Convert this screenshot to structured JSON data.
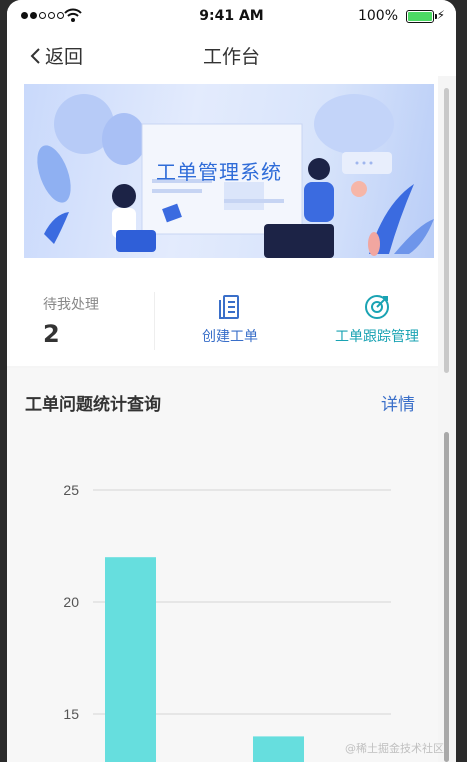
{
  "status_bar": {
    "time": "9:41 AM",
    "battery": "100%"
  },
  "nav": {
    "back_label": "返回",
    "title": "工作台"
  },
  "banner": {
    "title": "工单管理系统"
  },
  "quick": {
    "pending_label": "待我处理",
    "pending_count": "2",
    "create_label": "创建工单",
    "track_label": "工单跟踪管理"
  },
  "stats": {
    "title": "工单问题统计查询",
    "detail_label": "详情"
  },
  "colors": {
    "accent": "#3a6fc9",
    "teal": "#1aa3b3",
    "bar": "#66dede"
  },
  "chart_data": {
    "type": "bar",
    "y_ticks": [
      15,
      20,
      25
    ],
    "ylim": [
      14,
      25
    ],
    "categories": [
      "",
      ""
    ],
    "values": [
      22,
      14
    ]
  },
  "watermark": "@稀土掘金技术社区"
}
